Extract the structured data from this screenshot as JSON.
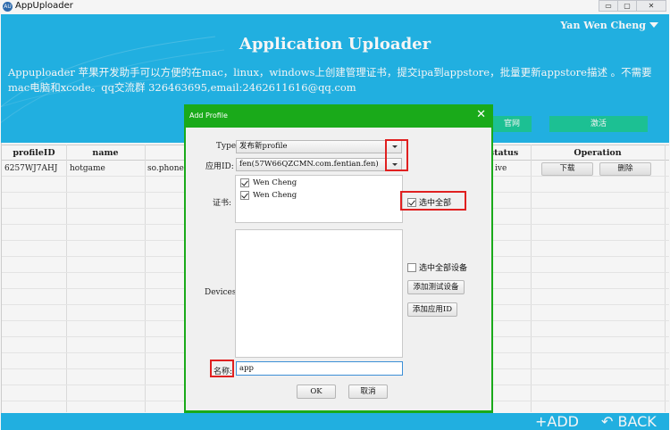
{
  "window": {
    "icon_text": "AU",
    "title": "AppUploader",
    "controls": [
      "▭",
      "▢",
      "✕"
    ]
  },
  "header": {
    "user_name": "Yan Wen Cheng",
    "title": "Application Uploader",
    "description": "Appuploader 苹果开发助手可以方便的在mac，linux，windows上创建管理证书，提交ipa到appstore，批量更新appstore描述 。不需要mac电脑和xcode。qq交流群 326463695,email:2462611616@qq.com",
    "official_site_button": "官网",
    "activate_button": "激活",
    "bg_color": "#23b7ea",
    "button_color": "#1ec89a"
  },
  "table": {
    "columns": [
      "profileID",
      "name",
      "status",
      "Operation"
    ],
    "rows": [
      {
        "profile_id": "6257WJ7AHJ",
        "name": "hotgame",
        "bundle": "so.phonegam",
        "status": "ive",
        "download_label": "下载",
        "delete_label": "删除"
      }
    ]
  },
  "footer": {
    "add_label": "+ADD",
    "back_label": "↶ BACK"
  },
  "dialog": {
    "title": "Add Profile",
    "close_label": "✕",
    "type_label": "Type:",
    "type_value": "发布新profile",
    "appid_label": "应用ID:",
    "appid_value": "fen(57W66QZCMN.com.fentian.fen)",
    "cert_label": "证书:",
    "certificates": [
      {
        "name": "Wen Cheng",
        "checked": true
      },
      {
        "name": "Wen Cheng",
        "checked": true
      }
    ],
    "select_all_label": "选中全部",
    "devices_label": "Devices:",
    "select_all_devices_label": "选中全部设备",
    "add_test_device_label": "添加测试设备",
    "add_app_id_label": "添加应用ID",
    "name_label": "名称:",
    "name_value": "app",
    "ok_label": "OK",
    "cancel_label": "取消",
    "accent_color": "#1aaa1a",
    "highlight_color": "#e02020"
  }
}
